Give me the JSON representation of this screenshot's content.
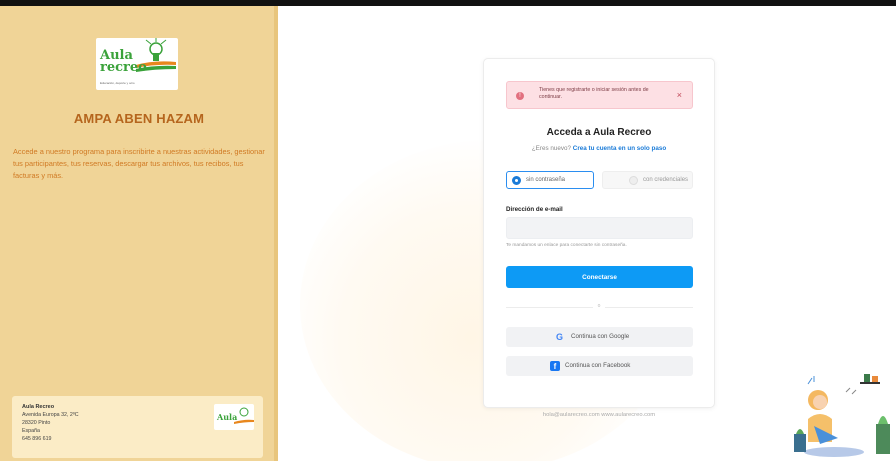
{
  "sidebar": {
    "org_name": "AMPA ABEN HAZAM",
    "logo": {
      "text": "Aula recreo",
      "tagline": "Educación, deporte y ocio"
    },
    "description": "Accede a nuestro programa para inscribirte a nuestras actividades, gestionar tus participantes, tus reservas, descargar tus archivos, tus recibos, tus facturas y más.",
    "footer": {
      "name": "Aula Recreo",
      "address": "Avenida Europa 32, 2ºC",
      "city": "28320 Pinto",
      "country": "España",
      "phone": "645 896 619",
      "mini_logo": "Aula"
    }
  },
  "login": {
    "alert": {
      "text": "Tienes que registrarte o iniciar sesión antes de continuar.",
      "close": "×"
    },
    "title": "Acceda a Aula Recreo",
    "subtitle_prefix": "¿Eres nuevo?",
    "subtitle_link": "Crea tu cuenta en un solo paso",
    "toggle": {
      "option1": "sin contraseña",
      "option2": "con credenciales",
      "selected": "option1"
    },
    "email": {
      "label": "Dirección de e-mail",
      "value": "",
      "placeholder": ""
    },
    "hint": "Te mandamos un enlace para conectarte sin contraseña.",
    "connect_button": "Conectarse",
    "divider": "o",
    "google_button": "Continua con Google",
    "facebook_button": "Continua con Facebook"
  },
  "contact_line": "hola@aularecreo.com  www.aularecreo.com",
  "colors": {
    "sidebar_bg": "#f0d497",
    "title_color": "#b5651d",
    "accent": "#0d9af5",
    "alert_bg": "#fde0e4"
  }
}
